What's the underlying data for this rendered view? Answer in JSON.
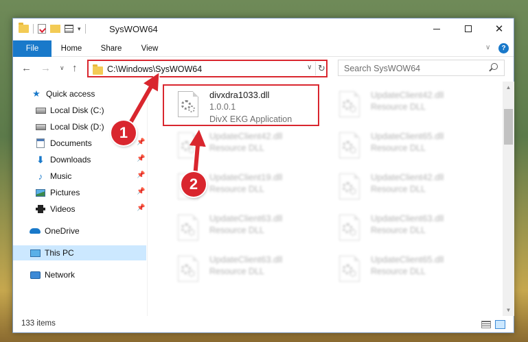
{
  "window": {
    "title": "SysWOW64",
    "controls": {
      "minimize": "",
      "maximize": "",
      "close": "✕"
    }
  },
  "ribbon": {
    "tabs": [
      {
        "label": "File",
        "active": true
      },
      {
        "label": "Home"
      },
      {
        "label": "Share"
      },
      {
        "label": "View"
      }
    ],
    "help": "?"
  },
  "navigation": {
    "back": "←",
    "forward": "→",
    "recent": "∨",
    "up": "↑",
    "address": "C:\\Windows\\SysWOW64",
    "search_placeholder": "Search SysWOW64"
  },
  "sidebar": {
    "items": [
      {
        "label": "Quick access",
        "icon": "star-icon",
        "pinned": false
      },
      {
        "label": "Local Disk (C:)",
        "icon": "disk-icon",
        "pinned": false
      },
      {
        "label": "Local Disk (D:)",
        "icon": "disk-icon",
        "pinned": false
      },
      {
        "label": "Documents",
        "icon": "documents-icon",
        "pinned": true
      },
      {
        "label": "Downloads",
        "icon": "downloads-icon",
        "pinned": true
      },
      {
        "label": "Music",
        "icon": "music-icon",
        "pinned": true
      },
      {
        "label": "Pictures",
        "icon": "pictures-icon",
        "pinned": true
      },
      {
        "label": "Videos",
        "icon": "videos-icon",
        "pinned": true
      },
      {
        "label": "OneDrive",
        "icon": "onedrive-icon",
        "pinned": false
      },
      {
        "label": "This PC",
        "icon": "this-pc-icon",
        "selected": true
      },
      {
        "label": "Network",
        "icon": "network-icon",
        "pinned": false
      }
    ]
  },
  "files": {
    "highlighted": {
      "name": "divxdra1033.dll",
      "version": "1.0.0.1",
      "description": "DivX EKG Application"
    },
    "blurred": [
      {
        "name": "UpdateClient42.dll",
        "type": "Resource DLL"
      },
      {
        "name": "UpdateClient42.dll",
        "type": "Resource DLL"
      },
      {
        "name": "UpdateClient65.dll",
        "type": "Resource DLL"
      },
      {
        "name": "UpdateClient19.dll",
        "type": "Resource DLL"
      },
      {
        "name": "UpdateClient42.dll",
        "type": "Resource DLL"
      },
      {
        "name": "UpdateClient63.dll",
        "type": "Resource DLL"
      },
      {
        "name": "UpdateClient63.dll",
        "type": "Resource DLL"
      },
      {
        "name": "UpdateClient63.dll",
        "type": "Resource DLL"
      },
      {
        "name": "UpdateClient65.dll",
        "type": "Resource DLL"
      }
    ]
  },
  "status": {
    "item_count": "133 items"
  },
  "annotations": {
    "badge_1": "1",
    "badge_2": "2",
    "color": "#d9262e"
  }
}
